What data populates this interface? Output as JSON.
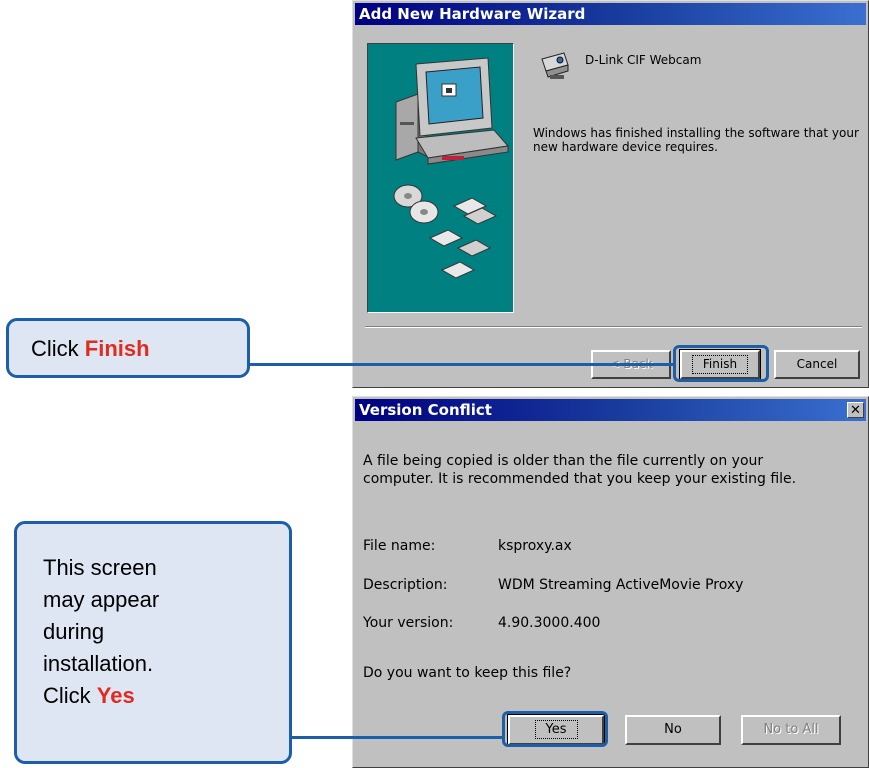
{
  "wizard": {
    "title": "Add New Hardware Wizard",
    "device_name": "D-Link CIF Webcam",
    "message": "Windows has finished installing the software that your new hardware device requires.",
    "buttons": {
      "back": "< Back",
      "finish": "Finish",
      "cancel": "Cancel"
    }
  },
  "conflict": {
    "title": "Version Conflict",
    "close": "✕",
    "message": "A file being copied is older than the file currently on your computer. It is recommended that you keep your existing file.",
    "fields": [
      {
        "label": "File name:",
        "value": "ksproxy.ax"
      },
      {
        "label": "Description:",
        "value": "WDM Streaming ActiveMovie Proxy"
      },
      {
        "label": "Your version:",
        "value": "4.90.3000.400"
      }
    ],
    "question": "Do you want to keep this file?",
    "buttons": {
      "yes": "Yes",
      "no": "No",
      "no_to_all": "No to All"
    }
  },
  "callouts": {
    "finish": {
      "prefix": "Click ",
      "accent": "Finish"
    },
    "yes": {
      "lines": [
        "This screen",
        "may appear",
        "during",
        "installation."
      ],
      "prefix": "Click ",
      "accent": "Yes"
    }
  },
  "colors": {
    "callout_border": "#1c5fa8",
    "callout_fill": "#dfe6f3",
    "accent": "#e02b1f",
    "titlebar": "#000080",
    "wizard_panel": "#008080"
  }
}
